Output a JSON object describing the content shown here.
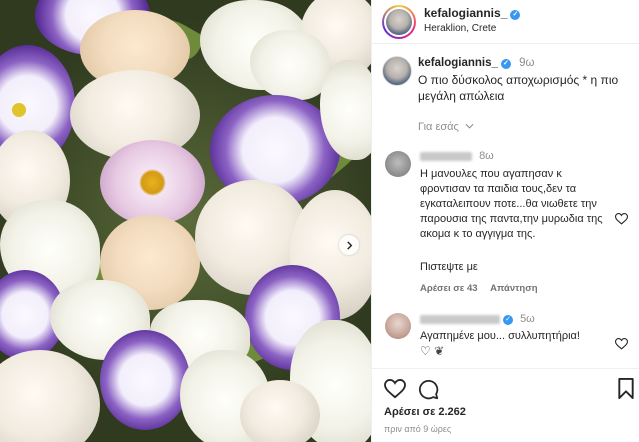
{
  "post": {
    "author": {
      "username": "kefalogiannis_",
      "verified": true,
      "location": "Heraklion, Crete"
    },
    "caption": {
      "username": "kefalogiannis_",
      "time": "9ω",
      "text": "Ο πιο δύσκολος αποχωρισμός * η πιο μεγάλη απώλεια"
    },
    "for_you_label": "Για εσάς",
    "comments": [
      {
        "username_hidden": true,
        "time": "8ω",
        "text": "Η μανουλες που αγαπησαν κ φροντισαν τα παιδια τους,δεν τα εγκαταλειπουν ποτε...θα νιωθετε την παρουσια της παντα,την μυρωδια της ακομα κ το αγγιγμα της.",
        "text2": "Πιστεψτε με",
        "likes_label": "Αρέσει σε 43",
        "reply_label": "Απάντηση"
      },
      {
        "username_hidden": true,
        "verified": true,
        "time": "5ω",
        "text": "Αγαπημένε μου... συλλυπητήρια!",
        "emoji": "♡ ❦"
      }
    ],
    "likes_label": "Αρέσει σε 2.262",
    "time_ago": "πριν από 9 ώρες",
    "colors": {
      "verified": "#3897f0",
      "text": "#262626",
      "muted": "#8e8e8e",
      "border": "#efefef"
    },
    "icons": [
      "heart-icon",
      "comment-icon",
      "bookmark-icon",
      "chevron-right-icon",
      "chevron-down-icon",
      "verified-badge-icon"
    ]
  }
}
